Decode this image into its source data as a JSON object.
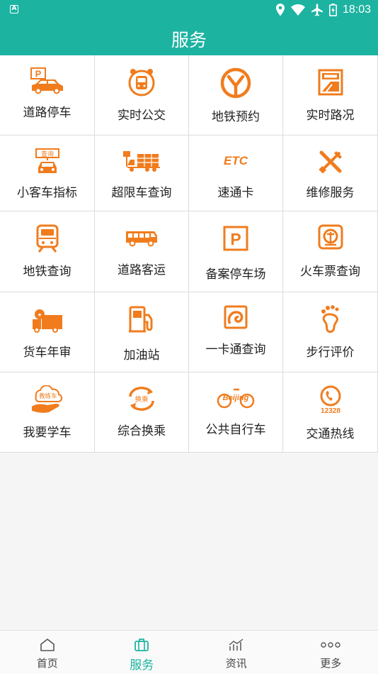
{
  "status_bar": {
    "time": "18:03",
    "left_icon": "A",
    "icons": [
      "location-icon",
      "wifi-icon",
      "airplane-icon",
      "battery-icon"
    ]
  },
  "header": {
    "title": "服务"
  },
  "accent_color": "#1cb3a1",
  "icon_color": "#f07c1e",
  "grid": [
    [
      {
        "label": "道路停车",
        "icon": "parking-car-icon"
      },
      {
        "label": "实时公交",
        "icon": "bus-clock-icon"
      },
      {
        "label": "地铁预约",
        "icon": "metro-clock-icon"
      },
      {
        "label": "实时路况",
        "icon": "road-condition-icon"
      }
    ],
    [
      {
        "label": "小客车指标",
        "icon": "car-query-icon"
      },
      {
        "label": "超限车查询",
        "icon": "overload-truck-icon"
      },
      {
        "label": "速通卡",
        "icon": "etc-icon"
      },
      {
        "label": "维修服务",
        "icon": "repair-tools-icon"
      }
    ],
    [
      {
        "label": "地铁查询",
        "icon": "subway-train-icon"
      },
      {
        "label": "道路客运",
        "icon": "coach-bus-icon"
      },
      {
        "label": "备案停车场",
        "icon": "parking-lot-icon"
      },
      {
        "label": "火车票查询",
        "icon": "railway-ticket-icon"
      }
    ],
    [
      {
        "label": "货车年审",
        "icon": "truck-inspection-icon"
      },
      {
        "label": "加油站",
        "icon": "gas-station-icon"
      },
      {
        "label": "一卡通查询",
        "icon": "transit-card-icon"
      },
      {
        "label": "步行评价",
        "icon": "footprint-icon"
      }
    ],
    [
      {
        "label": "我要学车",
        "icon": "driving-school-icon"
      },
      {
        "label": "综合换乘",
        "icon": "transfer-icon"
      },
      {
        "label": "公共自行车",
        "icon": "bicycle-icon"
      },
      {
        "label": "交通热线",
        "icon": "hotline-icon"
      }
    ]
  ],
  "icon_text": {
    "cha_xun": "查询",
    "etc": "ETC",
    "huan_cheng": "换乘",
    "jiao_lian_che": "教练车",
    "beijing": "Beijing",
    "hotline": "12328"
  },
  "tabs": [
    {
      "label": "首页",
      "icon": "home-icon"
    },
    {
      "label": "服务",
      "icon": "briefcase-icon",
      "active": true
    },
    {
      "label": "资讯",
      "icon": "chart-icon"
    },
    {
      "label": "更多",
      "icon": "more-icon"
    }
  ]
}
